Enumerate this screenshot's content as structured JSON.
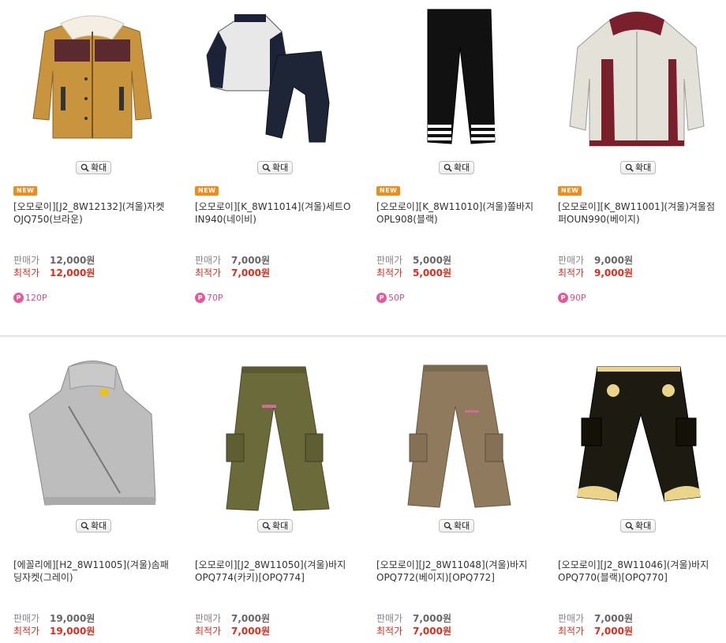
{
  "ui": {
    "zoom_label": "확대",
    "new_label": "NEW",
    "price_label": "판매가",
    "best_label": "최적가"
  },
  "products": [
    {
      "name": "[오모로이][J2_8W12132](겨울)자켓OJQ750(브라운)",
      "price": "12,000원",
      "best": "12,000원",
      "point": "120P",
      "is_new": true,
      "image": "brown-corduroy-jacket"
    },
    {
      "name": "[오모로이][K_8W11014](겨울)세트OIN940(네이비)",
      "price": "7,000원",
      "best": "7,000원",
      "point": "70P",
      "is_new": true,
      "image": "navy-tracksuit-set"
    },
    {
      "name": "[오모로이][K_8W11010](겨울)쫄바지OPL908(블랙)",
      "price": "5,000원",
      "best": "5,000원",
      "point": "50P",
      "is_new": true,
      "image": "black-leggings"
    },
    {
      "name": "[오모로이][K_8W11001](겨울)겨울점퍼OUN990(베이지)",
      "price": "9,000원",
      "best": "9,000원",
      "point": "90P",
      "is_new": true,
      "image": "beige-winter-jumper"
    },
    {
      "name": "[에꼴리에][H2_8W11005](겨울)솜패딩자켓(그레이)",
      "price": "19,000원",
      "best": "19,000원",
      "image": "grey-padded-jacket"
    },
    {
      "name": "[오모로이][J2_8W11050](겨울)바지OPQ774(카키)[OPQ774]",
      "price": "7,000원",
      "best": "7,000원",
      "image": "khaki-cargo-pants"
    },
    {
      "name": "[오모로이][J2_8W11048](겨울)바지OPQ772(베이지)[OPQ772]",
      "price": "7,000원",
      "best": "7,000원",
      "image": "beige-cargo-pants"
    },
    {
      "name": "[오모로이][J2_8W11046](겨울)바지OPQ770(블랙)[OPQ770]",
      "price": "7,000원",
      "best": "7,000원",
      "image": "black-corduroy-pants"
    }
  ]
}
